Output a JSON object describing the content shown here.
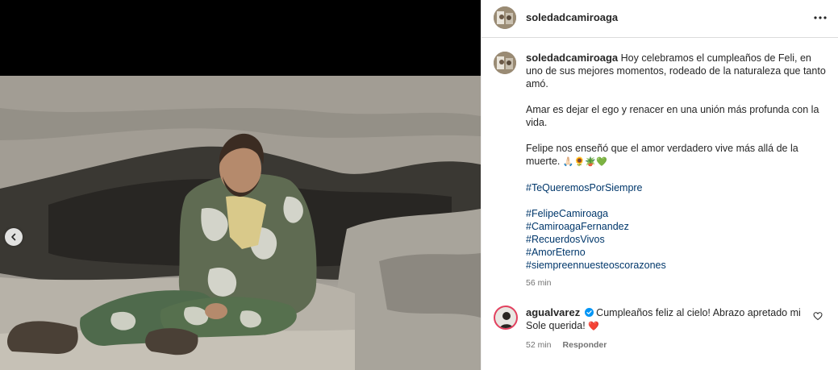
{
  "post": {
    "author": "soledadcamiroaga",
    "more_icon": "more-horizontal-icon"
  },
  "caption": {
    "username": "soledadcamiroaga",
    "text_1": "Hoy celebramos el cumpleaños de Feli, en uno de sus mejores momentos, rodeado de la naturaleza que tanto amó.",
    "text_2": "Amar es dejar el ego y renacer en una unión más profunda con la vida.",
    "text_3": "Felipe nos enseñó que el amor verdadero vive más allá de la muerte.",
    "emojis": "🙏🏻🌻🪴💚",
    "hashtag_main": "#TeQueremosPorSiempre",
    "hashtags": [
      "#FelipeCamiroaga",
      "#CamiroagaFernandez",
      "#RecuerdosVivos",
      "#AmorEterno",
      "#siempreennuesteoscorazones"
    ],
    "time": "56 min"
  },
  "comment": {
    "username": "agualvarez",
    "text": "Cumpleaños feliz al cielo! Abrazo apretado mi Sole querida!",
    "emoji": "❤️",
    "time": "52 min",
    "reply_label": "Responder"
  },
  "colors": {
    "link": "#00376b",
    "muted": "#737373",
    "verified": "#0095f6",
    "heart": "#ed4956"
  }
}
